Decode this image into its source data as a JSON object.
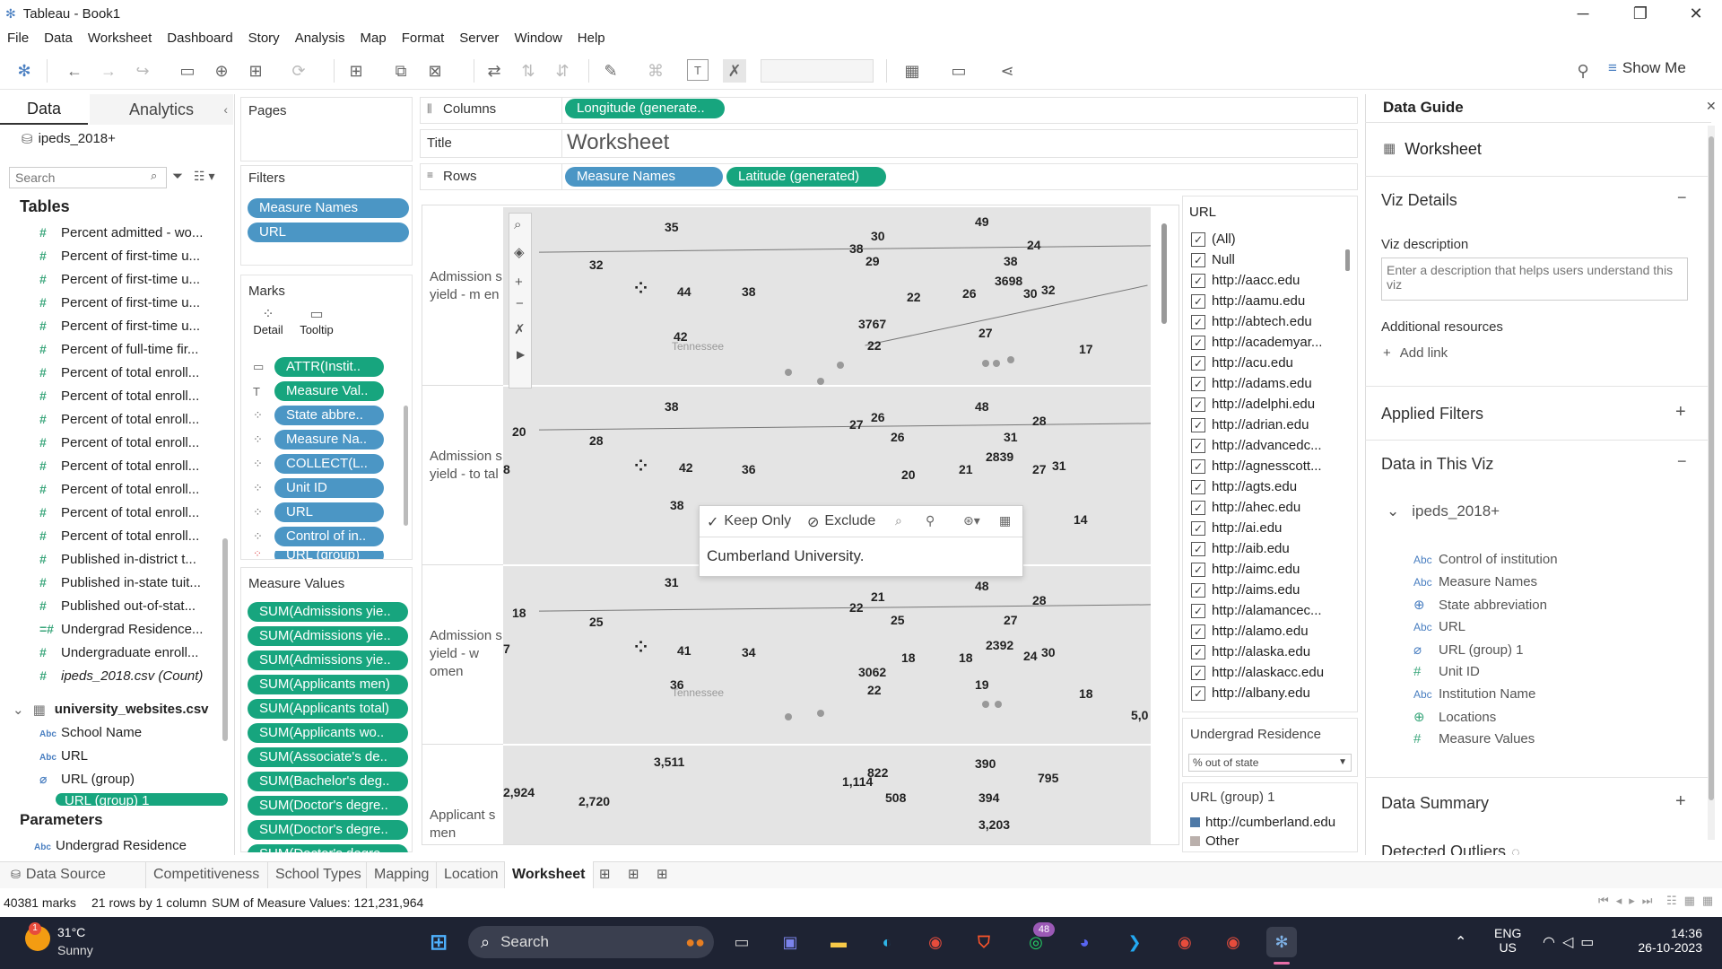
{
  "window": {
    "title": "Tableau - Book1",
    "minimize": "─",
    "maximize": "❐",
    "close": "✕"
  },
  "menu": [
    "File",
    "Data",
    "Worksheet",
    "Dashboard",
    "Story",
    "Analysis",
    "Map",
    "Format",
    "Server",
    "Window",
    "Help"
  ],
  "toolbar": {
    "show_me": "Show Me"
  },
  "left": {
    "tab_data": "Data",
    "tab_analytics": "Analytics",
    "datasource": "ipeds_2018+",
    "search_placeholder": "Search",
    "tables_header": "Tables",
    "fields": [
      "Percent admitted - wo...",
      "Percent of first-time u...",
      "Percent of first-time u...",
      "Percent of first-time u...",
      "Percent of first-time u...",
      "Percent of full-time fir...",
      "Percent of total enroll...",
      "Percent of total enroll...",
      "Percent of total enroll...",
      "Percent of total enroll...",
      "Percent of total enroll...",
      "Percent of total enroll...",
      "Percent of total enroll...",
      "Percent of total enroll...",
      "Published in-district t...",
      "Published in-state tuit...",
      "Published out-of-stat...",
      "Undergrad Residence...",
      "Undergraduate enroll...",
      "ipeds_2018.csv (Count)"
    ],
    "second_table": "university_websites.csv",
    "second_fields": [
      "School Name",
      "URL",
      "URL (group)",
      "URL (group) 1"
    ],
    "parameters_header": "Parameters",
    "parameter": "Undergrad Residence"
  },
  "pages_label": "Pages",
  "filters": {
    "label": "Filters",
    "pills": [
      "Measure Names",
      "URL"
    ]
  },
  "marks": {
    "label": "Marks",
    "detail": "Detail",
    "tooltip": "Tooltip",
    "pills": [
      "ATTR(Instit..",
      "Measure Val..",
      "State abbre..",
      "Measure Na..",
      "COLLECT(L..",
      "Unit ID",
      "URL",
      "Control of in..",
      "URL (group)"
    ]
  },
  "measure_values": {
    "label": "Measure Values",
    "pills": [
      "SUM(Admissions yie..",
      "SUM(Admissions yie..",
      "SUM(Admissions yie..",
      "SUM(Applicants men)",
      "SUM(Applicants total)",
      "SUM(Applicants wo..",
      "SUM(Associate's de..",
      "SUM(Bachelor's deg..",
      "SUM(Doctor's degre..",
      "SUM(Doctor's degre..",
      "SUM(Doctor's degre.."
    ]
  },
  "shelves": {
    "columns_label": "Columns",
    "columns_pill": "Longitude (generate..",
    "title_label": "Title",
    "title_value": "Worksheet",
    "rows_label": "Rows",
    "rows_pills": [
      "Measure Names",
      "Latitude (generated)"
    ]
  },
  "viz": {
    "row_labels": [
      "Admission s yield - m en",
      "Admission s yield - to tal",
      "Admission s yield - w omen",
      "Applicant s men"
    ],
    "state_label": "Tennessee",
    "panel1_numbers": [
      "35",
      "30",
      "49",
      "24",
      "38",
      "29",
      "38",
      "32",
      "44",
      "38",
      "22",
      "26",
      "3698",
      "30",
      "32",
      "3767",
      "42",
      "27",
      "22",
      "17"
    ],
    "panel2_numbers": [
      "38",
      "26",
      "48",
      "28",
      "27",
      "26",
      "31",
      "20",
      "28",
      "42",
      "36",
      "20",
      "21",
      "2839",
      "27",
      "31",
      "8",
      "38",
      "14"
    ],
    "panel3_numbers": [
      "31",
      "21",
      "48",
      "28",
      "22",
      "25",
      "27",
      "18",
      "25",
      "41",
      "34",
      "18",
      "18",
      "2392",
      "24",
      "30",
      "3062",
      "36",
      "19",
      "22",
      "18",
      "7",
      "5,0"
    ],
    "panel4_numbers": [
      "3,511",
      "390",
      "795",
      "822",
      "1,114",
      "508",
      "394",
      "2,924",
      "2,720",
      "3,203"
    ],
    "tooltip": {
      "keep_only": "Keep Only",
      "exclude": "Exclude",
      "text": "Cumberland University."
    }
  },
  "url_filter": {
    "title": "URL",
    "items": [
      "(All)",
      "Null",
      "http://aacc.edu",
      "http://aamu.edu",
      "http://abtech.edu",
      "http://academyar...",
      "http://acu.edu",
      "http://adams.edu",
      "http://adelphi.edu",
      "http://adrian.edu",
      "http://advancedc...",
      "http://agnesscott...",
      "http://agts.edu",
      "http://ahec.edu",
      "http://ai.edu",
      "http://aib.edu",
      "http://aimc.edu",
      "http://aims.edu",
      "http://alamancec...",
      "http://alamo.edu",
      "http://alaska.edu",
      "http://alaskacc.edu",
      "http://albany.edu"
    ]
  },
  "undergrad_param": {
    "title": "Undergrad Residence",
    "value": "% out of state"
  },
  "url_group_legend": {
    "title": "URL (group) 1",
    "items": [
      "http://cumberland.edu",
      "Other"
    ],
    "colors": [
      "#4e79a7",
      "#bab0ac"
    ]
  },
  "guide": {
    "title": "Data Guide",
    "worksheet": "Worksheet",
    "viz_details": "Viz Details",
    "viz_description_label": "Viz description",
    "viz_description_placeholder": "Enter a description that helps users understand this viz",
    "additional_resources": "Additional resources",
    "add_link": "Add link",
    "applied_filters": "Applied Filters",
    "data_in_viz": "Data in This Viz",
    "source": "ipeds_2018+",
    "fields": [
      {
        "type": "Abc",
        "name": "Control of institution"
      },
      {
        "type": "Abc",
        "name": "Measure Names"
      },
      {
        "type": "globe",
        "name": "State abbreviation"
      },
      {
        "type": "Abc",
        "name": "URL"
      },
      {
        "type": "clip",
        "name": "URL (group) 1"
      },
      {
        "type": "#",
        "name": "Unit ID"
      },
      {
        "type": "Abc",
        "name": "Institution Name"
      },
      {
        "type": "globe",
        "name": "Locations"
      },
      {
        "type": "#",
        "name": "Measure Values"
      }
    ],
    "data_summary": "Data Summary",
    "detected_outliers": "Detected Outliers"
  },
  "sheet_tabs": [
    "Data Source",
    "Competitiveness",
    "School Types",
    "Mapping",
    "Location",
    "Worksheet"
  ],
  "status": {
    "marks": "40381 marks",
    "rows": "21 rows by 1 column",
    "sum": "SUM of Measure Values: 121,231,964"
  },
  "taskbar": {
    "weather_temp": "31°C",
    "weather_desc": "Sunny",
    "weather_badge": "1",
    "search": "Search",
    "whatsapp_badge": "48",
    "lang1": "ENG",
    "lang2": "US",
    "time": "14:36",
    "date": "26-10-2023"
  }
}
